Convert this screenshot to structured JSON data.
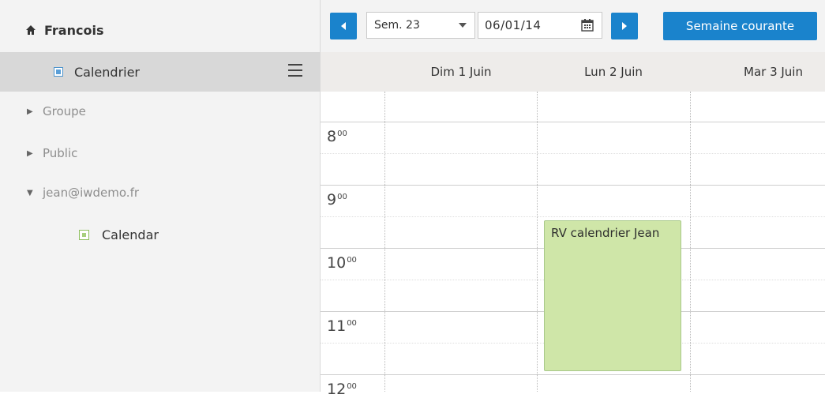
{
  "sidebar": {
    "user": {
      "icon": "home-icon",
      "name": "Francois"
    },
    "selected_calendar": {
      "label": "Calendrier",
      "color": "#5a9fd8"
    },
    "groups": [
      {
        "label": "Groupe",
        "expanded": false
      },
      {
        "label": "Public",
        "expanded": false
      },
      {
        "label": "jean@iwdemo.fr",
        "expanded": true
      }
    ],
    "shared_calendar": {
      "label": "Calendar",
      "color": "#a8cf7e"
    }
  },
  "toolbar": {
    "week_select": "Sem. 23",
    "date_value": "06/01/14",
    "current_week_label": "Semaine courante",
    "accent_color": "#1a83cc"
  },
  "days": [
    {
      "label": "Dim 1 Juin"
    },
    {
      "label": "Lun 2 Juin"
    },
    {
      "label": "Mar 3 Juin"
    }
  ],
  "hours": [
    {
      "h": "8",
      "m": "00"
    },
    {
      "h": "9",
      "m": "00"
    },
    {
      "h": "10",
      "m": "00"
    },
    {
      "h": "11",
      "m": "00"
    },
    {
      "h": "12",
      "m": "00"
    }
  ],
  "event": {
    "title": "RV calendrier Jean",
    "day": "Lun 2 Juin",
    "color": "#cfe6a8"
  }
}
